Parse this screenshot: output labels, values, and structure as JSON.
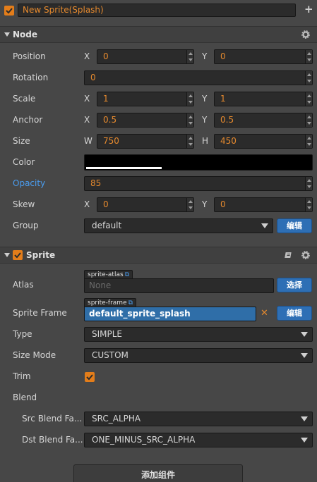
{
  "node_name": "New Sprite(Splash)",
  "node_section": {
    "title": "Node",
    "position": {
      "label": "Position",
      "x_label": "X",
      "x": "0",
      "y_label": "Y",
      "y": "0"
    },
    "rotation": {
      "label": "Rotation",
      "value": "0"
    },
    "scale": {
      "label": "Scale",
      "x_label": "X",
      "x": "1",
      "y_label": "Y",
      "y": "1"
    },
    "anchor": {
      "label": "Anchor",
      "x_label": "X",
      "x": "0.5",
      "y_label": "Y",
      "y": "0.5"
    },
    "size": {
      "label": "Size",
      "w_label": "W",
      "w": "750",
      "h_label": "H",
      "h": "450"
    },
    "color": {
      "label": "Color",
      "value": "#000000"
    },
    "opacity": {
      "label": "Opacity",
      "value": "85"
    },
    "skew": {
      "label": "Skew",
      "x_label": "X",
      "x": "0",
      "y_label": "Y",
      "y": "0"
    },
    "group": {
      "label": "Group",
      "value": "default",
      "edit_label": "编辑"
    }
  },
  "sprite_section": {
    "title": "Sprite",
    "enabled": true,
    "atlas": {
      "label": "Atlas",
      "tag": "sprite-atlas",
      "value": "None",
      "button": "选择"
    },
    "sprite_frame": {
      "label": "Sprite Frame",
      "tag": "sprite-frame",
      "value": "default_sprite_splash",
      "button": "编辑"
    },
    "type": {
      "label": "Type",
      "value": "SIMPLE"
    },
    "size_mode": {
      "label": "Size Mode",
      "value": "CUSTOM"
    },
    "trim": {
      "label": "Trim",
      "checked": true
    },
    "blend": {
      "label": "Blend"
    },
    "src_blend": {
      "label": "Src Blend Fa...",
      "value": "SRC_ALPHA"
    },
    "dst_blend": {
      "label": "Dst Blend Fa...",
      "value": "ONE_MINUS_SRC_ALPHA"
    }
  },
  "add_component_label": "添加组件",
  "colors": {
    "accent": "#e68a2e",
    "checkbox": "#e37d1a",
    "highlight_label": "#4a9df0",
    "button_blue": "#2e6fb5",
    "panel_bg": "#474747"
  }
}
